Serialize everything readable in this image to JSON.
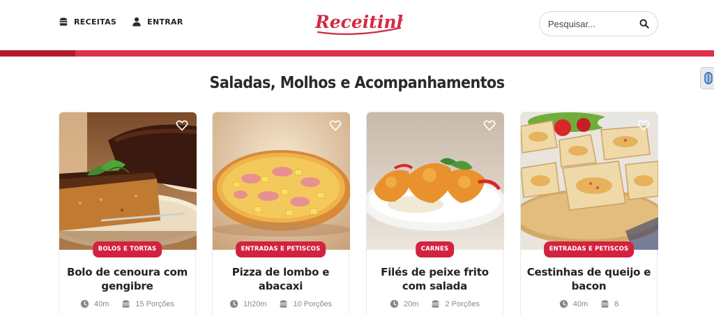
{
  "header": {
    "nav": [
      {
        "label": "RECEITAS",
        "icon": "burger-icon"
      },
      {
        "label": "ENTRAR",
        "icon": "user-icon"
      }
    ],
    "logo_text": "Receitinhas",
    "search_placeholder": "Pesquisar..."
  },
  "colors": {
    "brand": "#e0304b",
    "brand_dark": "#b21a32",
    "badge": "#d3223f"
  },
  "section": {
    "title": "Saladas, Molhos e Acompanhamentos"
  },
  "recipes": [
    {
      "category": "BOLOS E TORTAS",
      "title": "Bolo de cenoura com gengibre",
      "time": "40m",
      "servings": "15 Porções"
    },
    {
      "category": "ENTRADAS E PETISCOS",
      "title": "Pizza de lombo e abacaxi",
      "time": "1h20m",
      "servings": "10 Porções"
    },
    {
      "category": "CARNES",
      "title": "Filés de peixe frito com salada",
      "time": "20m",
      "servings": "2 Porções"
    },
    {
      "category": "ENTRADAS E PETISCOS",
      "title": "Cestinhas de queijo e bacon",
      "time": "40m",
      "servings": "8"
    }
  ]
}
